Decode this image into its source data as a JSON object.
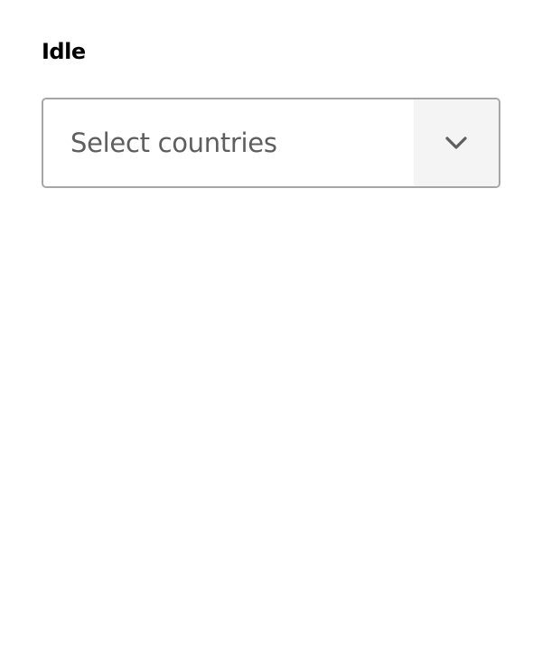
{
  "field": {
    "label": "Idle",
    "placeholder": "Select countries",
    "toggle_icon": "chevron-down-icon"
  },
  "colors": {
    "border": "#a6a6a6",
    "placeholder_text": "#5e5e5e",
    "toggle_background": "#f4f4f4",
    "icon": "#5e5e5e"
  }
}
